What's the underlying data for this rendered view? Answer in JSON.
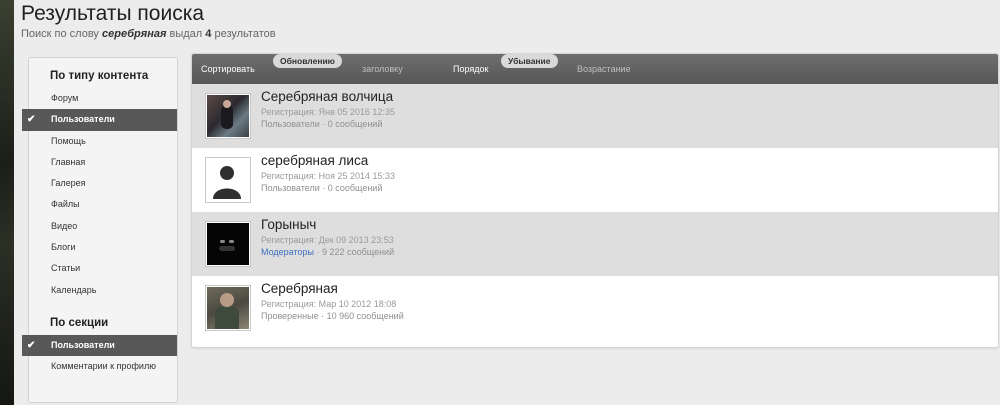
{
  "header": {
    "title": "Результаты поиска",
    "sub_prefix": "Поиск по слову ",
    "query": "серебряная",
    "sub_mid": " выдал ",
    "count": "4",
    "sub_suffix": " результатов"
  },
  "sidebar": {
    "section1_title": "По типу контента",
    "items": [
      {
        "label": "Форум"
      },
      {
        "label": "Пользователи",
        "active": true
      },
      {
        "label": "Помощь"
      },
      {
        "label": "Главная"
      },
      {
        "label": "Галерея"
      },
      {
        "label": "Файлы"
      },
      {
        "label": "Видео"
      },
      {
        "label": "Блоги"
      },
      {
        "label": "Статьи"
      },
      {
        "label": "Календарь"
      }
    ],
    "section2_title": "По секции",
    "items2": [
      {
        "label": "Пользователи",
        "active": true
      },
      {
        "label": "Комментарии к профилю"
      }
    ]
  },
  "sortbar": {
    "sort_label": "Сортировать",
    "sort_active": "Обновлению",
    "sort_other": "заголовку",
    "order_label": "Порядок",
    "order_active": "Убывание",
    "order_other": "Возрастание"
  },
  "results": [
    {
      "name": "Серебряная волчица",
      "reg": "Регистрация: Янв 05 2016 12:35",
      "group": "Пользователи",
      "posts": " · 0 сообщений",
      "avatar": "photo-avatar"
    },
    {
      "name": "серебряная лиса",
      "reg": "Регистрация: Ноя 25 2014 15:33",
      "group": "Пользователи",
      "posts": " · 0 сообщений",
      "avatar": "default-avatar"
    },
    {
      "name": "Горыныч",
      "reg": "Регистрация: Дек 09 2013 23:53",
      "group": "Модераторы",
      "posts": " · 9 222 сообщений",
      "avatar": "dark-avatar"
    },
    {
      "name": "Серебряная",
      "reg": "Регистрация: Мар 10 2012 18:08",
      "group": "Проверенные",
      "posts": " · 10 960 сообщений",
      "avatar": "photo-avatar"
    }
  ],
  "colors": {
    "active_bg": "#585858",
    "link": "#3d6fc1",
    "row_alt": "#dedede"
  }
}
